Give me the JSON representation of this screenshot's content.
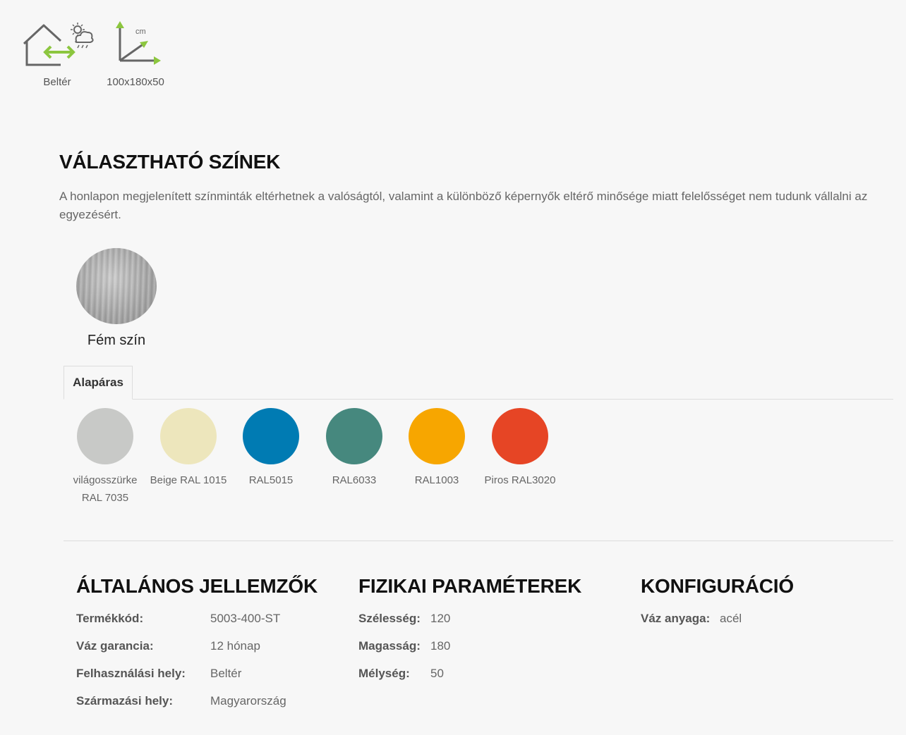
{
  "features": {
    "indoor_label": "Beltér",
    "indoor_icon": "indoor-house-icon",
    "dims_label": "100x180x50",
    "dims_icon": "dimensions-axes-icon",
    "dims_unit": "cm"
  },
  "colors": {
    "title": "VÁLASZTHATÓ SZÍNEK",
    "note": "A honlapon megjelenített színminták eltérhetnek a valóságtól, valamint a különböző képernyők eltérő minősége miatt felelősséget nem tudunk vállalni az egyezésért.",
    "metal_label": "Fém szín",
    "tab_label": "Alapáras",
    "swatches": [
      {
        "name_line1": "világosszürke",
        "name_line2": "RAL 7035",
        "hex": "#c8c9c7"
      },
      {
        "name_line1": "Beige RAL 1015",
        "name_line2": "",
        "hex": "#ede6bc"
      },
      {
        "name_line1": "RAL5015",
        "name_line2": "",
        "hex": "#007bb3"
      },
      {
        "name_line1": "RAL6033",
        "name_line2": "",
        "hex": "#46887e"
      },
      {
        "name_line1": "RAL1003",
        "name_line2": "",
        "hex": "#f7a600"
      },
      {
        "name_line1": "Piros RAL3020",
        "name_line2": "",
        "hex": "#e64525"
      }
    ]
  },
  "general": {
    "title": "ÁLTALÁNOS JELLEMZŐK",
    "rows": [
      {
        "key": "Termékkód:",
        "value": "5003-400-ST"
      },
      {
        "key": "Váz garancia:",
        "value": "12 hónap"
      },
      {
        "key": "Felhasználási hely:",
        "value": "Beltér"
      },
      {
        "key": "Származási hely:",
        "value": "Magyarország"
      }
    ]
  },
  "physical": {
    "title": "FIZIKAI PARAMÉTEREK",
    "rows": [
      {
        "key": "Szélesség:",
        "value": "120"
      },
      {
        "key": "Magasság:",
        "value": "180"
      },
      {
        "key": "Mélység:",
        "value": "50"
      }
    ]
  },
  "config": {
    "title": "KONFIGURÁCIÓ",
    "rows": [
      {
        "key": "Váz anyaga:",
        "value": "acél"
      }
    ]
  },
  "accent": "#8cc63f"
}
